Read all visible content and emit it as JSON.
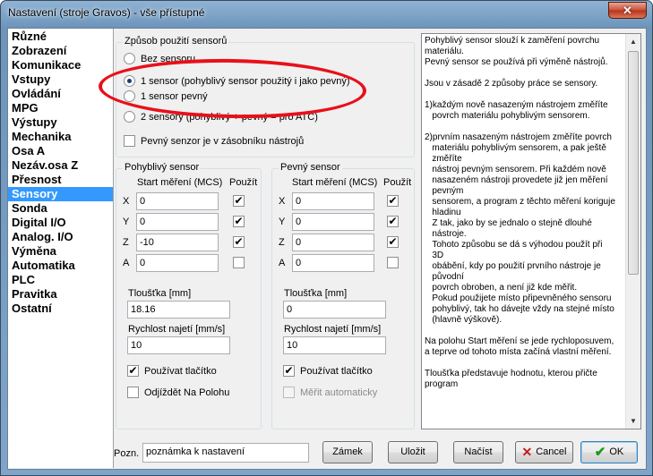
{
  "window": {
    "title": "Nastavení (stroje Gravos) - vše přístupné",
    "close_glyph": "✕"
  },
  "sidebar": {
    "items": [
      {
        "label": "Různé"
      },
      {
        "label": "Zobrazení"
      },
      {
        "label": "Komunikace"
      },
      {
        "label": "Vstupy"
      },
      {
        "label": "Ovládání"
      },
      {
        "label": "MPG"
      },
      {
        "label": "Výstupy"
      },
      {
        "label": "Mechanika"
      },
      {
        "label": "Osa A"
      },
      {
        "label": "Nezáv.osa Z"
      },
      {
        "label": "Přesnost"
      },
      {
        "label": "Sensory"
      },
      {
        "label": "Sonda"
      },
      {
        "label": "Digital I/O"
      },
      {
        "label": "Analog. I/O"
      },
      {
        "label": "Výměna"
      },
      {
        "label": "Automatika"
      },
      {
        "label": "PLC"
      },
      {
        "label": "Pravitka"
      },
      {
        "label": "Ostatní"
      }
    ],
    "selected": "Sensory"
  },
  "mode": {
    "title": "Způsob použití sensorů",
    "options": [
      {
        "label": "Bez sensoru",
        "checked": false
      },
      {
        "label": "1 sensor (pohyblivý sensor použitý i jako pevný)",
        "checked": true
      },
      {
        "label": "1 sensor pevný",
        "checked": false
      },
      {
        "label": "2 sensory (pohyblivý + pevný = pro ATC)",
        "checked": false
      }
    ],
    "magazine_label": "Pevný senzor je v zásobníku nástrojů",
    "magazine_checked": false
  },
  "moving": {
    "title": "Pohyblivý sensor",
    "col_start": "Start měření (MCS)",
    "col_use": "Použít",
    "axes": [
      {
        "axis": "X",
        "value": "0",
        "use": true
      },
      {
        "axis": "Y",
        "value": "0",
        "use": true
      },
      {
        "axis": "Z",
        "value": "-10",
        "use": true
      },
      {
        "axis": "A",
        "value": "0",
        "use": false
      }
    ],
    "thickness_label": "Tloušťka [mm]",
    "thickness_value": "18.16",
    "speed_label": "Rychlost najetí [mm/s]",
    "speed_value": "10",
    "button_label": "Používat tlačítko",
    "button_checked": true,
    "extra_label": "Odjíždět Na Polohu",
    "extra_checked": false
  },
  "fixed": {
    "title": "Pevný sensor",
    "col_start": "Start měření (MCS)",
    "col_use": "Použít",
    "axes": [
      {
        "axis": "X",
        "value": "0",
        "use": true
      },
      {
        "axis": "Y",
        "value": "0",
        "use": true
      },
      {
        "axis": "Z",
        "value": "0",
        "use": true
      },
      {
        "axis": "A",
        "value": "0",
        "use": false
      }
    ],
    "thickness_label": "Tloušťka [mm]",
    "thickness_value": "0",
    "speed_label": "Rychlost najetí [mm/s]",
    "speed_value": "10",
    "button_label": "Používat tlačítko",
    "button_checked": true,
    "extra_label": "Měřit automaticky",
    "extra_checked": false,
    "extra_disabled": true
  },
  "help": {
    "text": "Pohyblivý sensor slouží k zaměření povrchu materiálu.\nPevný sensor se používá při výměně nástrojů.\n\nJsou v zásadě 2 způsoby práce se sensory.\n\n1)každým nově nasazeným nástrojem změříte\n   povrch materiálu pohyblivým sensorem.\n\n2)prvním nasazeným nástrojem změříte povrch\n   materiálu pohyblivým sensorem, a pak ještě\n   změříte\n   nástroj pevným sensorem. Při každém nově\n   nasazeném nástroji provedete již jen měření\n   pevným\n   sensorem, a program z těchto měření koriguje\n   hladinu\n   Z tak, jako by se jednalo o stejně dlouhé\n   nástroje.\n   Tohoto způsobu se dá s výhodou použít při\n   3D\n   obábění, kdy po použití prvního nástroje je\n   původní\n   povrch obroben, a není již kde měřit.\n   Pokud použijete místo připevněného sensoru\n   pohyblivý, tak ho dávejte vždy na stejné místo\n   (hlavně výškově).\n\nNa polohu Start měření se jede rychloposuvem,\na teprve od tohoto místa začíná vlastní měření.\n\nTloušťka představuje hodnotu, kterou přičte\nprogram"
  },
  "footer": {
    "note_label": "Pozn.",
    "note_value": "poznámka k nastavení",
    "lock": "Zámek",
    "save": "Uložit",
    "load": "Načíst",
    "cancel": "Cancel",
    "ok": "OK"
  },
  "colors": {
    "selection": "#3399ff",
    "annotation": "#e8101a"
  }
}
